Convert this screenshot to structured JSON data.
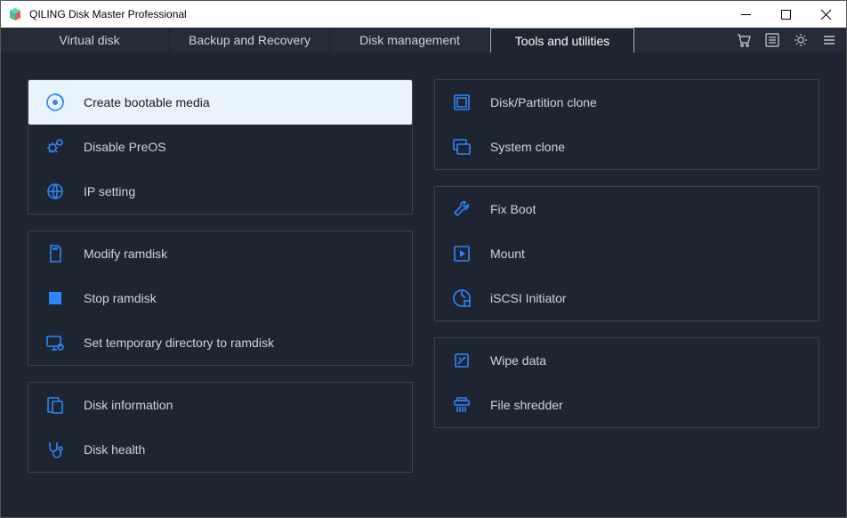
{
  "window_title": "QILING Disk Master Professional",
  "tabs": {
    "virtual_disk": "Virtual disk",
    "backup_recovery": "Backup and Recovery",
    "disk_management": "Disk management",
    "tools_utilities": "Tools and utilities",
    "active": "tools_utilities"
  },
  "left_groups": [
    {
      "items": [
        {
          "id": "create-bootable-media",
          "label": "Create bootable media",
          "icon": "disc-icon",
          "selected": true
        },
        {
          "id": "disable-preos",
          "label": "Disable PreOS",
          "icon": "gears-icon",
          "selected": false
        },
        {
          "id": "ip-setting",
          "label": "IP setting",
          "icon": "globe-icon",
          "selected": false
        }
      ]
    },
    {
      "items": [
        {
          "id": "modify-ramdisk",
          "label": "Modify ramdisk",
          "icon": "sdcard-icon",
          "selected": false
        },
        {
          "id": "stop-ramdisk",
          "label": "Stop ramdisk",
          "icon": "stop-icon",
          "selected": false
        },
        {
          "id": "set-temp-ramdisk",
          "label": "Set temporary directory to ramdisk",
          "icon": "monitor-gear-icon",
          "selected": false
        }
      ]
    },
    {
      "items": [
        {
          "id": "disk-information",
          "label": "Disk information",
          "icon": "disk-info-icon",
          "selected": false
        },
        {
          "id": "disk-health",
          "label": "Disk health",
          "icon": "stethoscope-icon",
          "selected": false
        }
      ]
    }
  ],
  "right_groups": [
    {
      "items": [
        {
          "id": "disk-partition-clone",
          "label": "Disk/Partition clone",
          "icon": "partition-icon",
          "selected": false
        },
        {
          "id": "system-clone",
          "label": "System clone",
          "icon": "system-clone-icon",
          "selected": false
        }
      ]
    },
    {
      "items": [
        {
          "id": "fix-boot",
          "label": "Fix Boot",
          "icon": "wrench-icon",
          "selected": false
        },
        {
          "id": "mount",
          "label": "Mount",
          "icon": "play-box-icon",
          "selected": false
        },
        {
          "id": "iscsi-initiator",
          "label": "iSCSI Initiator",
          "icon": "iscsi-icon",
          "selected": false
        }
      ]
    },
    {
      "items": [
        {
          "id": "wipe-data",
          "label": "Wipe data",
          "icon": "wipe-icon",
          "selected": false
        },
        {
          "id": "file-shredder",
          "label": "File shredder",
          "icon": "shredder-icon",
          "selected": false
        }
      ]
    }
  ],
  "toolbar_icons": [
    "cart-icon",
    "list-icon",
    "gear-icon",
    "menu-icon"
  ]
}
